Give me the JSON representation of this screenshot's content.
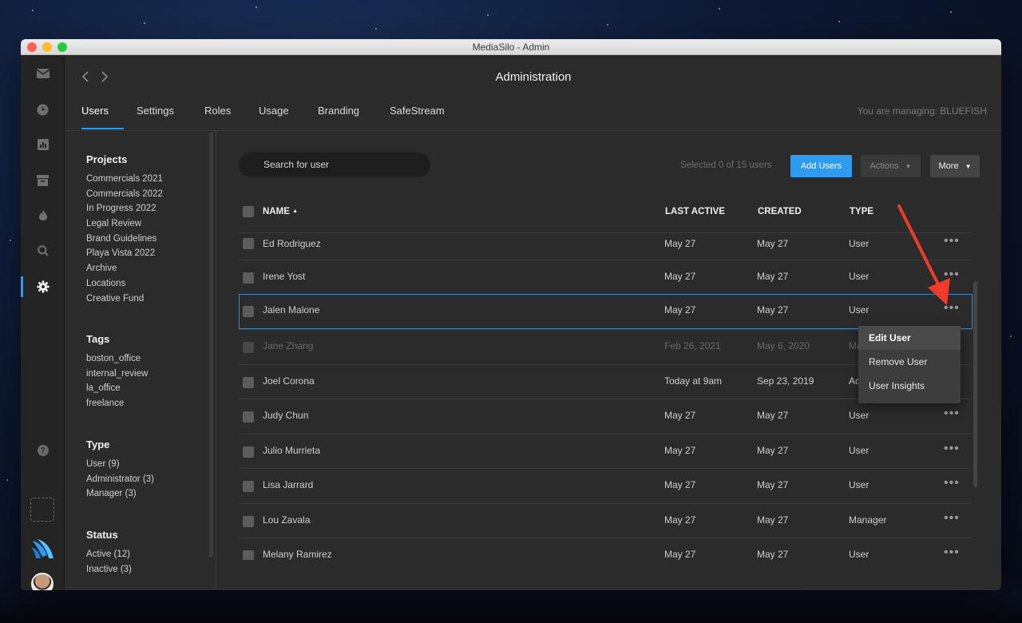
{
  "window": {
    "title": "MediaSilo - Admin"
  },
  "header": {
    "title": "Administration",
    "managing": "You are managing: BLUEFISH",
    "tabs": [
      {
        "label": "Users",
        "active": true
      },
      {
        "label": "Settings"
      },
      {
        "label": "Roles"
      },
      {
        "label": "Usage"
      },
      {
        "label": "Branding"
      },
      {
        "label": "SafeStream"
      }
    ]
  },
  "sidebar_icons": [
    "mail-icon",
    "clock-icon",
    "chart-icon",
    "archive-icon",
    "flame-icon",
    "search-icon",
    "gear-icon",
    "help-icon"
  ],
  "filters": {
    "projects": {
      "title": "Projects",
      "items": [
        "Commercials 2021",
        "Commercials 2022",
        "In Progress 2022",
        "Legal Review",
        "Brand Guidelines",
        "Playa Vista 2022",
        "Archive",
        "Locations",
        "Creative Fund"
      ]
    },
    "tags": {
      "title": "Tags",
      "items": [
        "boston_office",
        "internal_review",
        "la_office",
        "freelance"
      ]
    },
    "type": {
      "title": "Type",
      "items": [
        "User (9)",
        "Administrator (3)",
        "Manager (3)"
      ]
    },
    "status": {
      "title": "Status",
      "items": [
        "Active (12)",
        "Inactive (3)"
      ]
    }
  },
  "toolbar": {
    "search_placeholder": "Search for user",
    "selected_count": "Selected 0 of 15 users",
    "add_users_label": "Add Users",
    "actions_label": "Actions",
    "more_label": "More"
  },
  "table": {
    "columns": [
      "NAME",
      "LAST ACTIVE",
      "CREATED",
      "TYPE"
    ],
    "sort_indicator": "▲",
    "rows": [
      {
        "name": "Ed Rodriguez",
        "last_active": "May 27",
        "created": "May 27",
        "type": "User"
      },
      {
        "name": "Irene Yost",
        "last_active": "May 27",
        "created": "May 27",
        "type": "User"
      },
      {
        "name": "Jalen Malone",
        "last_active": "May 27",
        "created": "May 27",
        "type": "User",
        "selected": true
      },
      {
        "name": "Jane Zhang",
        "last_active": "Feb 26, 2021",
        "created": "May 6, 2020",
        "type": "Ma",
        "inactive": true
      },
      {
        "name": "Joel Corona",
        "last_active": "Today at 9am",
        "created": "Sep 23, 2019",
        "type": "Ac"
      },
      {
        "name": "Judy Chun",
        "last_active": "May 27",
        "created": "May 27",
        "type": "User"
      },
      {
        "name": "Julio Murrieta",
        "last_active": "May 27",
        "created": "May 27",
        "type": "User"
      },
      {
        "name": "Lisa Jarrard",
        "last_active": "May 27",
        "created": "May 27",
        "type": "User"
      },
      {
        "name": "Lou Zavala",
        "last_active": "May 27",
        "created": "May 27",
        "type": "Manager"
      },
      {
        "name": "Melany Ramirez",
        "last_active": "May 27",
        "created": "May 27",
        "type": "User"
      }
    ]
  },
  "context_menu": {
    "items": [
      "Edit User",
      "Remove User",
      "User Insights"
    ],
    "hovered": "Edit User"
  },
  "colors": {
    "accent": "#2d9cf0",
    "annotation_arrow": "#f03a2a",
    "selected_row_border": "#3f88c5"
  }
}
